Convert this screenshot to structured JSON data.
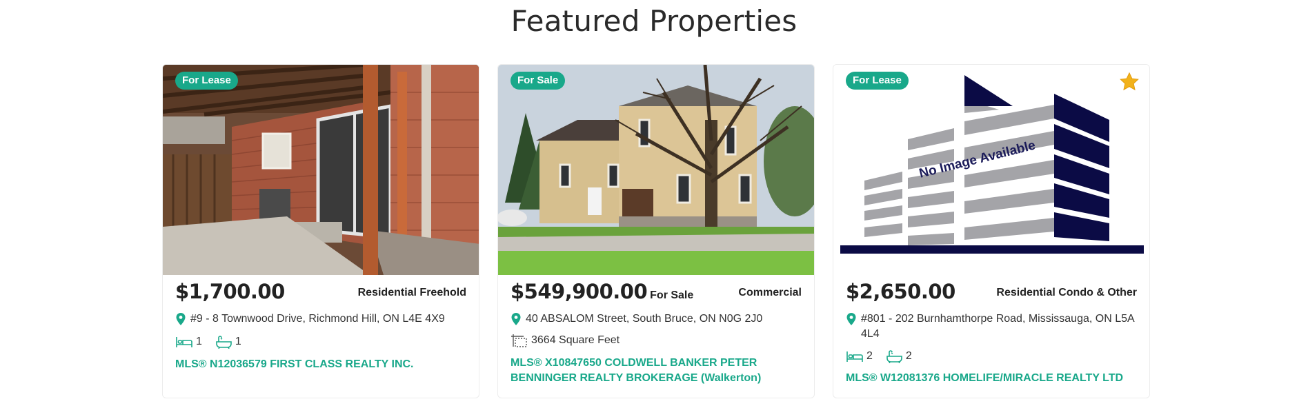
{
  "section_title": "Featured Properties",
  "colors": {
    "accent": "#19a88a",
    "text": "#222222",
    "navy": "#0b0b45"
  },
  "cards": [
    {
      "badge": "For Lease",
      "price": "$1,700.00",
      "price_suffix": "",
      "type": "Residential Freehold",
      "address": "#9 - 8 Townwood Drive, Richmond Hill, ON L4E 4X9",
      "beds": "1",
      "baths": "1",
      "mls": "MLS® N12036579 FIRST CLASS REALTY INC.",
      "photo": "brick-patio-photo"
    },
    {
      "badge": "For Sale",
      "price": "$549,900.00",
      "price_suffix": "For Sale",
      "type": "Commercial",
      "address": "40 ABSALOM Street, South Bruce, ON N0G 2J0",
      "area": "3664 Square Feet",
      "mls": "MLS® X10847650 COLDWELL BANKER PETER BENNINGER REALTY BROKERAGE (Walkerton)",
      "photo": "brick-house-tree-photo"
    },
    {
      "badge": "For Lease",
      "price": "$2,650.00",
      "price_suffix": "",
      "type": "Residential Condo & Other",
      "address": "#801 - 202 Burnhamthorpe Road, Mississauga, ON L5A 4L4",
      "beds": "2",
      "baths": "2",
      "mls": "MLS® W12081376 HOMELIFE/MIRACLE REALTY LTD",
      "placeholder_text": "No Image Available",
      "featured": true
    }
  ]
}
